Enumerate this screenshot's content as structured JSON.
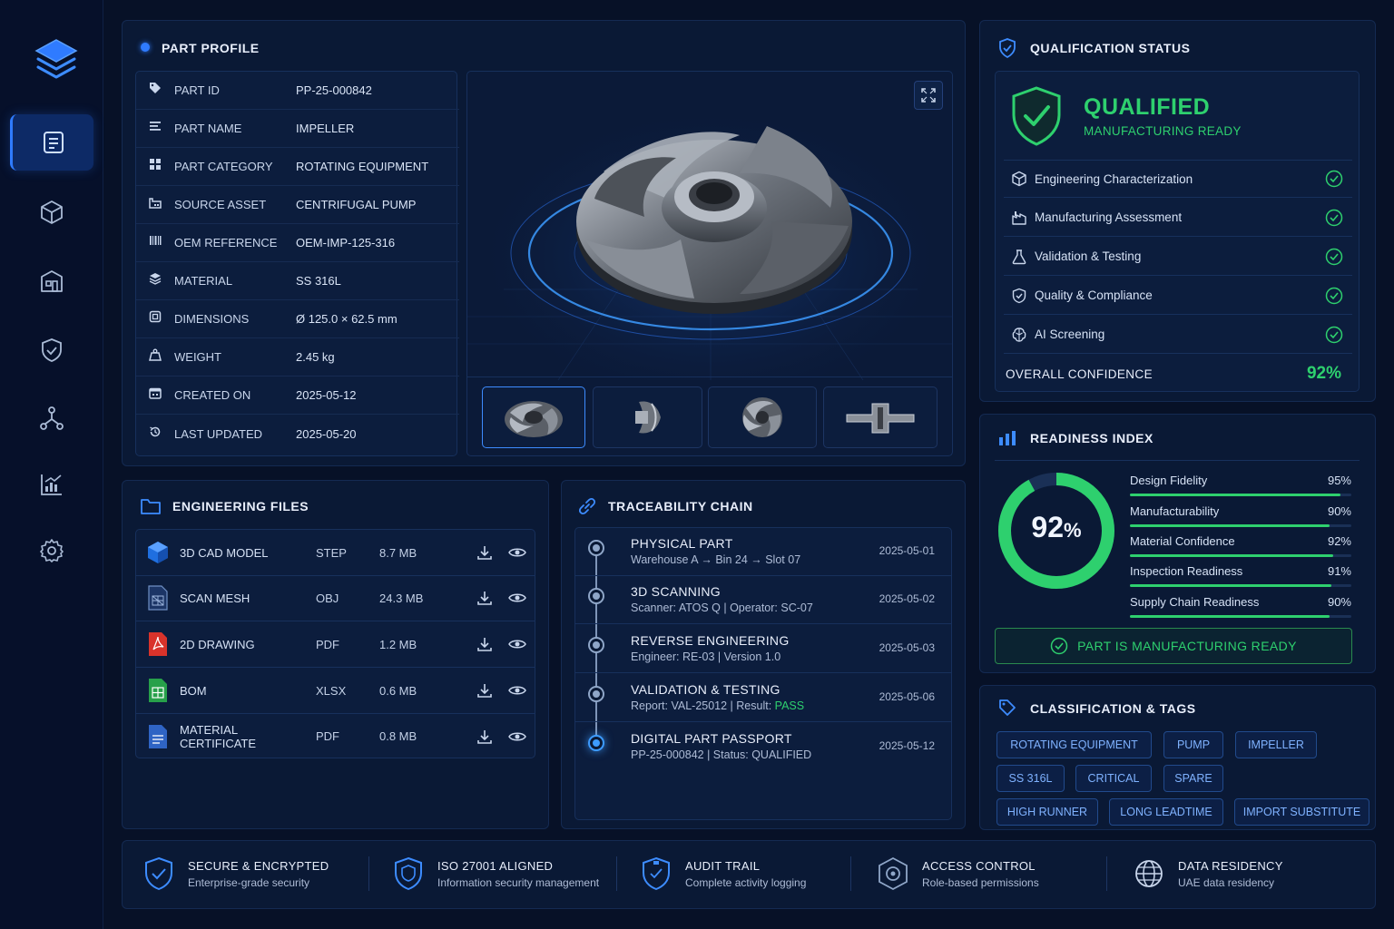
{
  "colors": {
    "accent": "#2f7bff",
    "success": "#2ed06e",
    "panel": "#0a1935",
    "background": "#071127"
  },
  "sidebar": {
    "items": [
      {
        "icon": "document-icon",
        "active": true
      },
      {
        "icon": "cube-icon"
      },
      {
        "icon": "factory-icon"
      },
      {
        "icon": "shield-check-icon"
      },
      {
        "icon": "network-icon"
      },
      {
        "icon": "analytics-icon"
      },
      {
        "icon": "gear-icon"
      }
    ]
  },
  "part_profile": {
    "title": "PART PROFILE",
    "rows": [
      {
        "icon": "tag-icon",
        "label": "PART ID",
        "value": "PP-25-000842"
      },
      {
        "icon": "list-icon",
        "label": "PART NAME",
        "value": "IMPELLER"
      },
      {
        "icon": "grid-icon",
        "label": "PART CATEGORY",
        "value": "ROTATING EQUIPMENT"
      },
      {
        "icon": "asset-icon",
        "label": "SOURCE ASSET",
        "value": "CENTRIFUGAL PUMP"
      },
      {
        "icon": "barcode-icon",
        "label": "OEM REFERENCE",
        "value": "OEM-IMP-125-316"
      },
      {
        "icon": "layers-icon",
        "label": "MATERIAL",
        "value": "SS 316L"
      },
      {
        "icon": "dimension-icon",
        "label": "DIMENSIONS",
        "value": "Ø 125.0 × 62.5 mm"
      },
      {
        "icon": "weight-icon",
        "label": "WEIGHT",
        "value": "2.45 kg"
      },
      {
        "icon": "calendar-icon",
        "label": "CREATED ON",
        "value": "2025-05-12"
      },
      {
        "icon": "history-icon",
        "label": "LAST UPDATED",
        "value": "2025-05-20"
      }
    ]
  },
  "viewer": {
    "expand_icon": "expand-icon",
    "thumbnails": [
      "impeller-front",
      "impeller-side",
      "impeller-top",
      "impeller-section"
    ]
  },
  "qualification": {
    "title": "QUALIFICATION STATUS",
    "status": "QUALIFIED",
    "substatus": "MANUFACTURING READY",
    "items": [
      {
        "icon": "cube-icon",
        "label": "Engineering Characterization"
      },
      {
        "icon": "factory-icon",
        "label": "Manufacturing Assessment"
      },
      {
        "icon": "flask-icon",
        "label": "Validation & Testing"
      },
      {
        "icon": "shield-check-icon",
        "label": "Quality & Compliance"
      },
      {
        "icon": "brain-icon",
        "label": "AI Screening"
      }
    ],
    "confidence_label": "OVERALL CONFIDENCE",
    "confidence_value": "92%"
  },
  "readiness": {
    "title": "READINESS INDEX",
    "score_number": "92",
    "score_unit": "%",
    "score": 92,
    "metrics": [
      {
        "label": "Design Fidelity",
        "value": "95%",
        "pct": 95
      },
      {
        "label": "Manufacturability",
        "value": "90%",
        "pct": 90
      },
      {
        "label": "Material Confidence",
        "value": "92%",
        "pct": 92
      },
      {
        "label": "Inspection Readiness",
        "value": "91%",
        "pct": 91
      },
      {
        "label": "Supply Chain Readiness",
        "value": "90%",
        "pct": 90
      }
    ],
    "banner": "PART IS MANUFACTURING READY"
  },
  "classification": {
    "title": "CLASSIFICATION & TAGS",
    "tags": [
      "ROTATING EQUIPMENT",
      "PUMP",
      "IMPELLER",
      "SS 316L",
      "CRITICAL",
      "SPARE",
      "HIGH RUNNER",
      "LONG LEADTIME",
      "IMPORT SUBSTITUTE"
    ]
  },
  "engineering_files": {
    "title": "ENGINEERING FILES",
    "files": [
      {
        "icon": "cad-cube-icon",
        "name": "3D CAD MODEL",
        "type": "STEP",
        "size": "8.7 MB"
      },
      {
        "icon": "mesh-file-icon",
        "name": "SCAN MESH",
        "type": "OBJ",
        "size": "24.3 MB"
      },
      {
        "icon": "pdf-file-icon",
        "name": "2D DRAWING",
        "type": "PDF",
        "size": "1.2 MB"
      },
      {
        "icon": "spreadsheet-file-icon",
        "name": "BOM",
        "type": "XLSX",
        "size": "0.6 MB"
      },
      {
        "icon": "document-file-icon",
        "name": "MATERIAL CERTIFICATE",
        "type": "PDF",
        "size": "0.8 MB"
      }
    ]
  },
  "traceability": {
    "title": "TRACEABILITY CHAIN",
    "steps": [
      {
        "title": "PHYSICAL PART",
        "sub": "Warehouse A → Bin 24 → Slot 07",
        "date": "2025-05-01"
      },
      {
        "title": "3D SCANNING",
        "sub": "Scanner: ATOS Q  |  Operator: SC-07",
        "date": "2025-05-02"
      },
      {
        "title": "REVERSE ENGINEERING",
        "sub": "Engineer: RE-03  |  Version 1.0",
        "date": "2025-05-03"
      },
      {
        "title": "VALIDATION & TESTING",
        "sub": "Report: VAL-25012  |  Result: ",
        "sub_highlight": "PASS",
        "date": "2025-05-06"
      },
      {
        "title": "DIGITAL PART PASSPORT",
        "sub": "PP-25-000842  |  Status: QUALIFIED",
        "date": "2025-05-12"
      }
    ]
  },
  "footer": {
    "items": [
      {
        "icon": "shield-check-icon",
        "title": "SECURE & ENCRYPTED",
        "sub": "Enterprise-grade security"
      },
      {
        "icon": "shield-iso-icon",
        "title": "ISO 27001 ALIGNED",
        "sub": "Information security management"
      },
      {
        "icon": "shield-audit-icon",
        "title": "AUDIT TRAIL",
        "sub": "Complete activity logging"
      },
      {
        "icon": "access-control-icon",
        "title": "ACCESS CONTROL",
        "sub": "Role-based permissions"
      },
      {
        "icon": "globe-icon",
        "title": "DATA RESIDENCY",
        "sub": "UAE data residency"
      }
    ]
  }
}
